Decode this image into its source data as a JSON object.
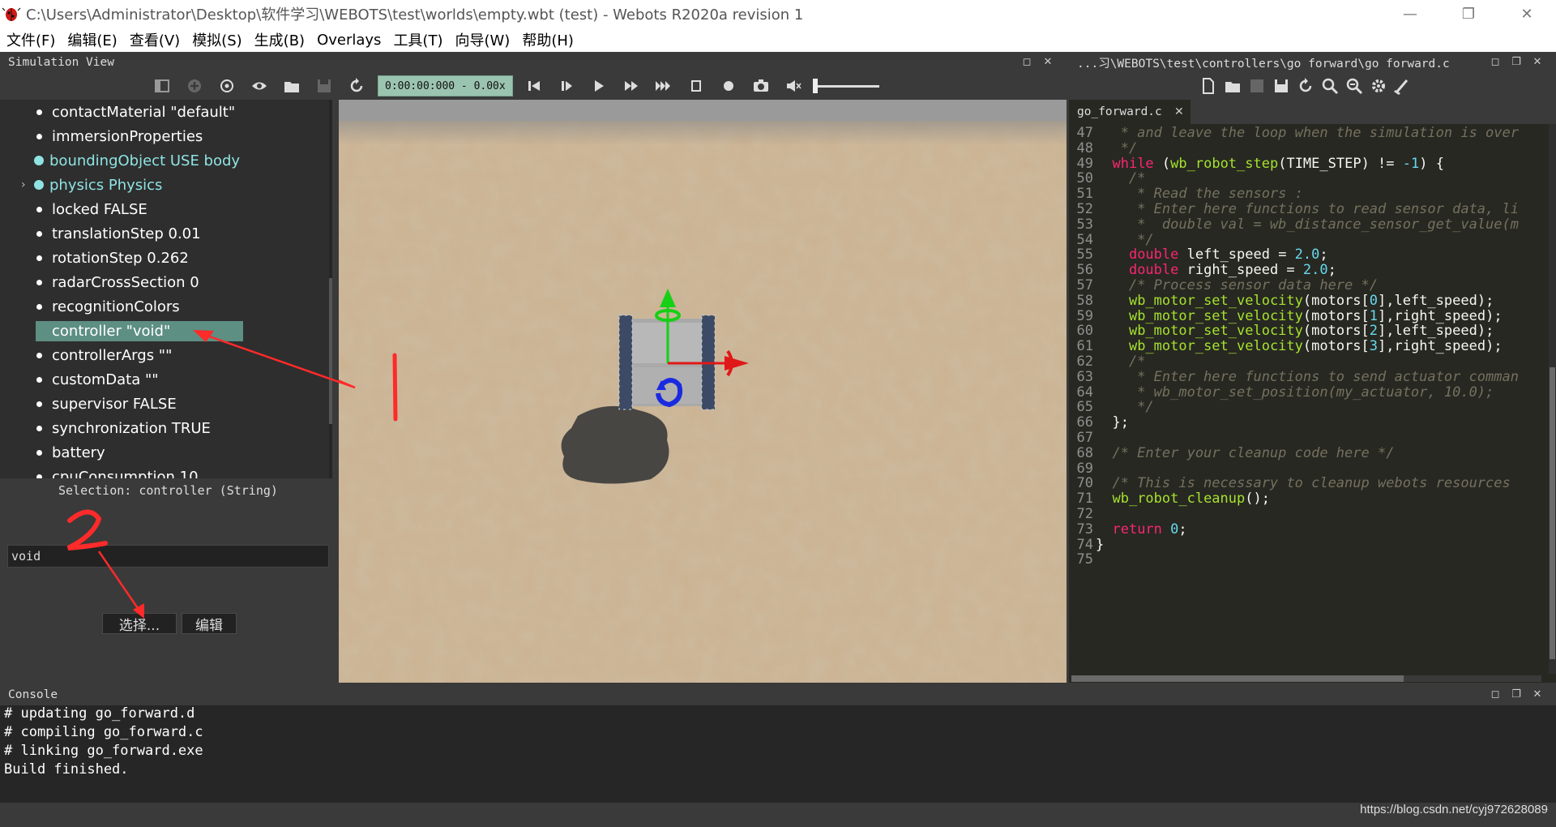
{
  "window": {
    "title": "C:\\Users\\Administrator\\Desktop\\软件学习\\WEBOTS\\test\\worlds\\empty.wbt (test) - Webots R2020a revision 1",
    "controls": {
      "minimize": "—",
      "restore": "❐",
      "close": "✕"
    }
  },
  "menu": [
    "文件(F)",
    "编辑(E)",
    "查看(V)",
    "模拟(S)",
    "生成(B)",
    "Overlays",
    "工具(T)",
    "向导(W)",
    "帮助(H)"
  ],
  "sim": {
    "dock_title": "Simulation View",
    "time": "0:00:00:000 - 0.00x"
  },
  "scene_tree": {
    "items": [
      {
        "label": "contactMaterial \"default\"",
        "style": "normal"
      },
      {
        "label": "immersionProperties",
        "style": "normal"
      },
      {
        "label": "boundingObject USE body",
        "style": "special"
      },
      {
        "label": "physics Physics",
        "style": "special",
        "expandable": true
      },
      {
        "label": "locked FALSE",
        "style": "normal"
      },
      {
        "label": "translationStep 0.01",
        "style": "normal"
      },
      {
        "label": "rotationStep 0.262",
        "style": "normal"
      },
      {
        "label": "radarCrossSection 0",
        "style": "normal"
      },
      {
        "label": "recognitionColors",
        "style": "normal"
      },
      {
        "label": "controller \"void\"",
        "style": "selected"
      },
      {
        "label": "controllerArgs \"\"",
        "style": "normal"
      },
      {
        "label": "customData \"\"",
        "style": "normal"
      },
      {
        "label": "supervisor FALSE",
        "style": "normal"
      },
      {
        "label": "synchronization TRUE",
        "style": "normal"
      },
      {
        "label": "battery",
        "style": "normal"
      },
      {
        "label": "cpuConsumption 10",
        "style": "normal"
      }
    ]
  },
  "field_editor": {
    "selection": "Selection: controller (String)",
    "value": "void",
    "select_button": "选择...",
    "edit_button": "编辑"
  },
  "annotations": {
    "mark1": "1",
    "mark2": "2",
    "color": "#ff2a2a"
  },
  "editor": {
    "dock_title": "...习\\WEBOTS\\test\\controllers\\go_forward\\go_forward.c",
    "tab": "go_forward.c",
    "tab_close": "✕"
  },
  "code_lines": [
    {
      "n": "47",
      "text": "   * and leave the loop when the simulation is over"
    },
    {
      "n": "48",
      "text": "   */"
    },
    {
      "n": "49",
      "text": "  while (wb_robot_step(TIME_STEP) != -1) {"
    },
    {
      "n": "50",
      "text": "    /*"
    },
    {
      "n": "51",
      "text": "     * Read the sensors :"
    },
    {
      "n": "52",
      "text": "     * Enter here functions to read sensor data, li"
    },
    {
      "n": "53",
      "text": "     *  double val = wb_distance_sensor_get_value(m"
    },
    {
      "n": "54",
      "text": "     */"
    },
    {
      "n": "55",
      "text": "    double left_speed = 2.0;"
    },
    {
      "n": "56",
      "text": "    double right_speed = 2.0;"
    },
    {
      "n": "57",
      "text": "    /* Process sensor data here */"
    },
    {
      "n": "58",
      "text": "    wb_motor_set_velocity(motors[0],left_speed);"
    },
    {
      "n": "59",
      "text": "    wb_motor_set_velocity(motors[1],right_speed);"
    },
    {
      "n": "60",
      "text": "    wb_motor_set_velocity(motors[2],left_speed);"
    },
    {
      "n": "61",
      "text": "    wb_motor_set_velocity(motors[3],right_speed);"
    },
    {
      "n": "62",
      "text": "    /*"
    },
    {
      "n": "63",
      "text": "     * Enter here functions to send actuator comman"
    },
    {
      "n": "64",
      "text": "     * wb_motor_set_position(my_actuator, 10.0);"
    },
    {
      "n": "65",
      "text": "     */"
    },
    {
      "n": "66",
      "text": "  };"
    },
    {
      "n": "67",
      "text": ""
    },
    {
      "n": "68",
      "text": "  /* Enter your cleanup code here */"
    },
    {
      "n": "69",
      "text": ""
    },
    {
      "n": "70",
      "text": "  /* This is necessary to cleanup webots resources"
    },
    {
      "n": "71",
      "text": "  wb_robot_cleanup();"
    },
    {
      "n": "72",
      "text": ""
    },
    {
      "n": "73",
      "text": "  return 0;"
    },
    {
      "n": "74",
      "text": "}"
    },
    {
      "n": "75",
      "text": ""
    }
  ],
  "console": {
    "title": "Console",
    "lines": [
      "# updating go_forward.d",
      "# compiling go_forward.c",
      "# linking go_forward.exe",
      "Build finished."
    ]
  },
  "watermark": "https://blog.csdn.net/cyj972628089",
  "colors": {
    "selection": "#5d8f82",
    "special_node": "#8fe3e3",
    "time_box": "#9bc4b0"
  }
}
